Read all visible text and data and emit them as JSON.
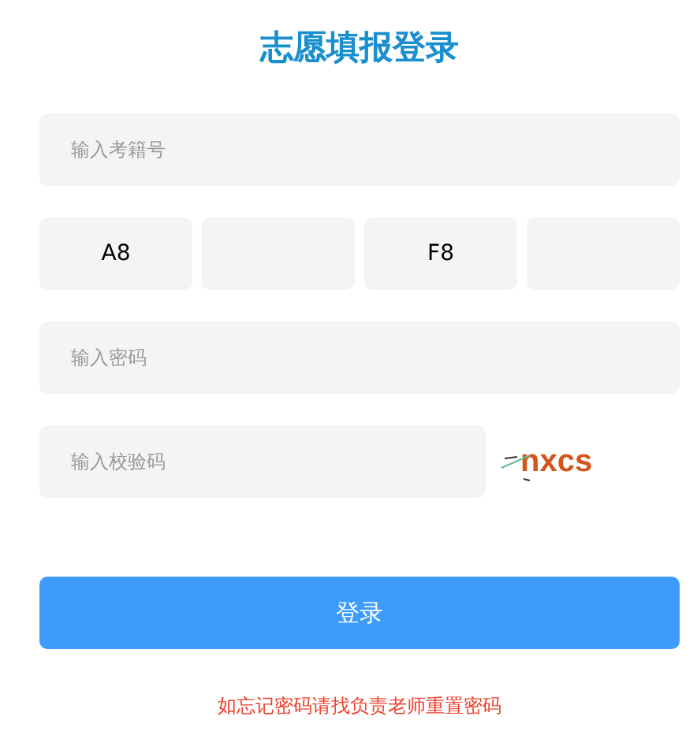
{
  "title": "志愿填报登录",
  "exam_number": {
    "placeholder": "输入考籍号"
  },
  "code_cells": [
    {
      "value": "A8"
    },
    {},
    {
      "value": "F8"
    },
    {}
  ],
  "password": {
    "placeholder": "输入密码"
  },
  "captcha": {
    "placeholder": "输入校验码",
    "image_text": "nxcs"
  },
  "login_button": "登录",
  "footer_note": "如忘记密码请找负责老师重置密码"
}
